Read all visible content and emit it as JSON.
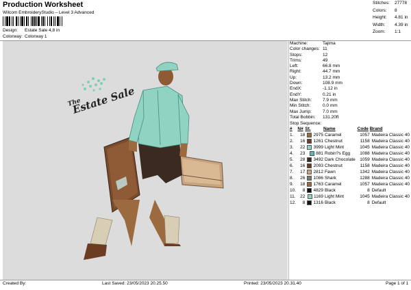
{
  "header": {
    "title": "Production Worksheet",
    "subtitle": "Wilcom EmbroideryStudio – Level 3 Advanced",
    "design_label": "Design:",
    "design_value": "Estate Sale 4,8 in",
    "colorway_label": "Colorway:",
    "colorway_value": "Colorway 1"
  },
  "top_stats": [
    {
      "label": "Stitches:",
      "value": "27778"
    },
    {
      "label": "Colors:",
      "value": "8"
    },
    {
      "label": "Height:",
      "value": "4.81 in"
    },
    {
      "label": "Width:",
      "value": "4.39 in"
    },
    {
      "label": "Zoom:",
      "value": "1:1"
    }
  ],
  "design_image": {
    "logo_small_text": "The",
    "logo_text": "Estate Sale"
  },
  "machine_info": [
    {
      "label": "Machine:",
      "value": "Tajima"
    },
    {
      "label": "Color changes:",
      "value": "11"
    },
    {
      "label": "Stops:",
      "value": "12"
    },
    {
      "label": "Trims:",
      "value": "49"
    },
    {
      "label": "Left:",
      "value": "66.8 mm"
    },
    {
      "label": "Right:",
      "value": "44.7 mm"
    },
    {
      "label": "Up:",
      "value": "13.2 mm"
    },
    {
      "label": "Down:",
      "value": "108.9 mm"
    },
    {
      "label": "EndX:",
      "value": "-1.12 in"
    },
    {
      "label": "EndY:",
      "value": "0.21 in"
    },
    {
      "label": "Max Stitch:",
      "value": "7.9 mm"
    },
    {
      "label": "Min Stitch:",
      "value": "0.0 mm"
    },
    {
      "label": "Max Jump:",
      "value": "7.0 mm"
    },
    {
      "label": "Total Bobbin:",
      "value": "131.20ft"
    }
  ],
  "stop_sequence": {
    "title": "Stop Sequence:",
    "columns": [
      "#",
      "N#",
      "St.",
      "Name",
      "Code",
      "Brand"
    ],
    "rows": [
      {
        "num": "1.",
        "n": "18",
        "st": "2975",
        "name": "Caramel",
        "code": "1057",
        "brand": "Madeira Classic 40",
        "color": "#9b6a3e"
      },
      {
        "num": "2.",
        "n": "16",
        "st": "1261",
        "name": "Chestnut",
        "code": "1158",
        "brand": "Madeira Classic 40",
        "color": "#6b3b22"
      },
      {
        "num": "3.",
        "n": "22",
        "st": "3999",
        "name": "Light Mint",
        "code": "1045",
        "brand": "Madeira Classic 40",
        "color": "#8fd4c2"
      },
      {
        "num": "4.",
        "n": "23",
        "st": "881",
        "name": "Robin?s Egg",
        "code": "1088",
        "brand": "Madeira Classic 40",
        "color": "#5fb8b0"
      },
      {
        "num": "5.",
        "n": "28",
        "st": "3492",
        "name": "Dark Chocolate",
        "code": "1059",
        "brand": "Madeira Classic 40",
        "color": "#3b2a20"
      },
      {
        "num": "6.",
        "n": "16",
        "st": "2093",
        "name": "Chestnut",
        "code": "1158",
        "brand": "Madeira Classic 40",
        "color": "#6b3b22"
      },
      {
        "num": "7.",
        "n": "17",
        "st": "2812",
        "name": "Fawn",
        "code": "1342",
        "brand": "Madeira Classic 40",
        "color": "#c9a27e"
      },
      {
        "num": "8.",
        "n": "26",
        "st": "1086",
        "name": "Shark",
        "code": "1288",
        "brand": "Madeira Classic 40",
        "color": "#7a7672"
      },
      {
        "num": "9.",
        "n": "18",
        "st": "1763",
        "name": "Caramel",
        "code": "1057",
        "brand": "Madeira Classic 40",
        "color": "#9b6a3e"
      },
      {
        "num": "10.",
        "n": "8",
        "st": "4829",
        "name": "Black",
        "code": "8",
        "brand": "Default",
        "color": "#111111"
      },
      {
        "num": "11.",
        "n": "22",
        "st": "1169",
        "name": "Light Mint",
        "code": "1045",
        "brand": "Madeira Classic 40",
        "color": "#8fd4c2"
      },
      {
        "num": "12.",
        "n": "8",
        "st": "1316",
        "name": "Black",
        "code": "8",
        "brand": "Default",
        "color": "#111111"
      }
    ]
  },
  "footer": {
    "created_by": "Created By:",
    "last_saved": "Last Saved: 23/05/2023 20.25.50",
    "printed": "Printed: 23/05/2023 20.31.40",
    "page": "Page 1 of 1"
  }
}
